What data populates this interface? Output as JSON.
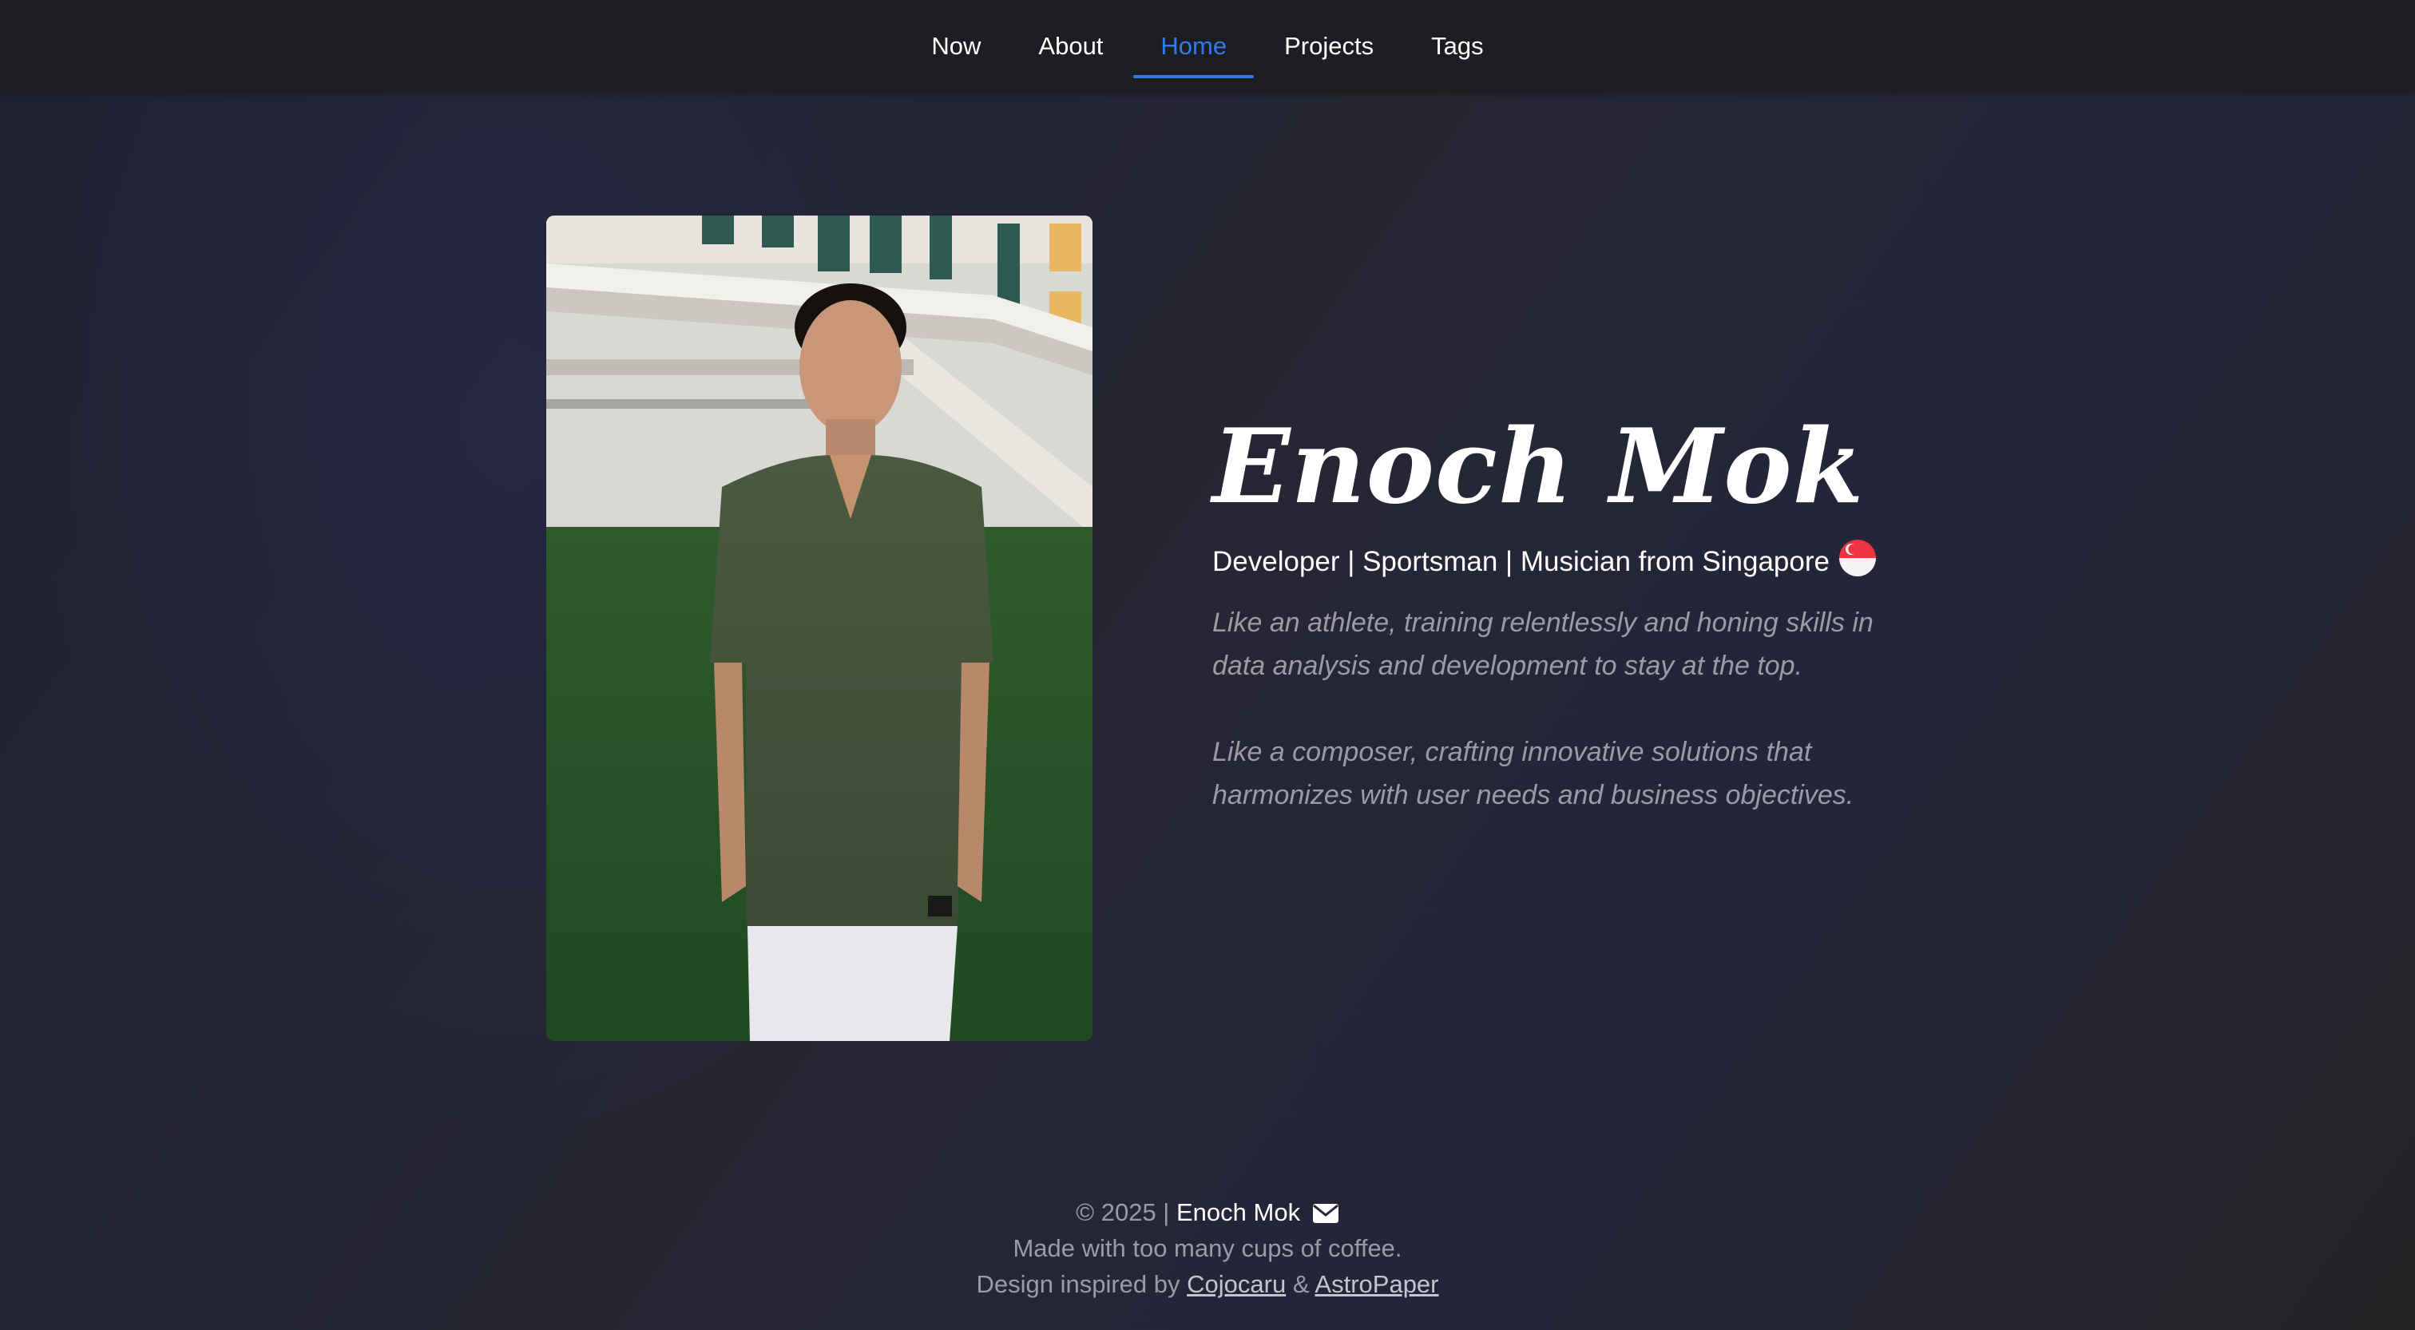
{
  "nav": {
    "items": [
      {
        "label": "Now",
        "active": false
      },
      {
        "label": "About",
        "active": false
      },
      {
        "label": "Home",
        "active": true
      },
      {
        "label": "Projects",
        "active": false
      },
      {
        "label": "Tags",
        "active": false
      }
    ]
  },
  "hero": {
    "name": "Enoch Mok",
    "tagline": "Developer | Sportsman | Musician from Singapore",
    "flag_icon": "singapore-flag-icon",
    "paragraphs": [
      "Like an athlete, training relentlessly and honing skills in data analysis and development to stay at the top.",
      "Like a composer, crafting innovative solutions that harmonizes with user needs and business objectives."
    ]
  },
  "footer": {
    "copyright": "© 2025 |",
    "owner": "Enoch Mok",
    "mail_icon": "mail-icon",
    "coffee": "Made with too many cups of coffee.",
    "inspired_prefix": "Design inspired by",
    "link1": "Cojocaru",
    "amp": "&",
    "link2": "AstroPaper"
  },
  "colors": {
    "accent": "#2f7bea",
    "muted": "#9b9ba6",
    "nav_bg": "#1e1e22"
  }
}
